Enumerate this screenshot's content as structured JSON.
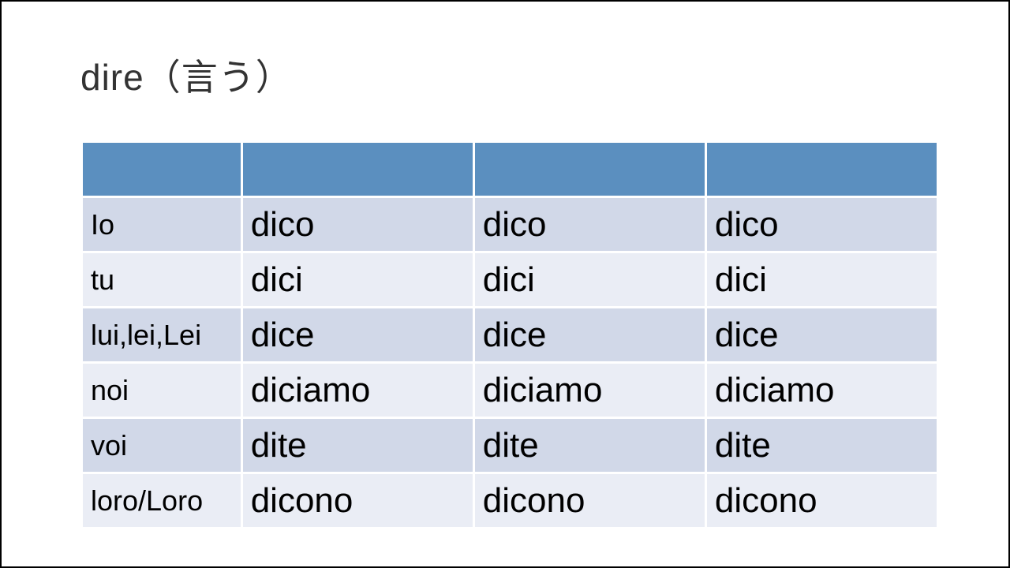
{
  "title": "dire（言う）",
  "chart_data": {
    "type": "table",
    "headers": [
      "",
      "",
      "",
      ""
    ],
    "rows": [
      [
        "Io",
        "dico",
        "dico",
        "dico"
      ],
      [
        "tu",
        "dici",
        "dici",
        "dici"
      ],
      [
        "lui,lei,Lei",
        "dice",
        "dice",
        "dice"
      ],
      [
        "noi",
        "diciamo",
        "diciamo",
        "diciamo"
      ],
      [
        "voi",
        "dite",
        "dite",
        "dite"
      ],
      [
        "loro/Loro",
        "dicono",
        "dicono",
        "dicono"
      ]
    ]
  }
}
